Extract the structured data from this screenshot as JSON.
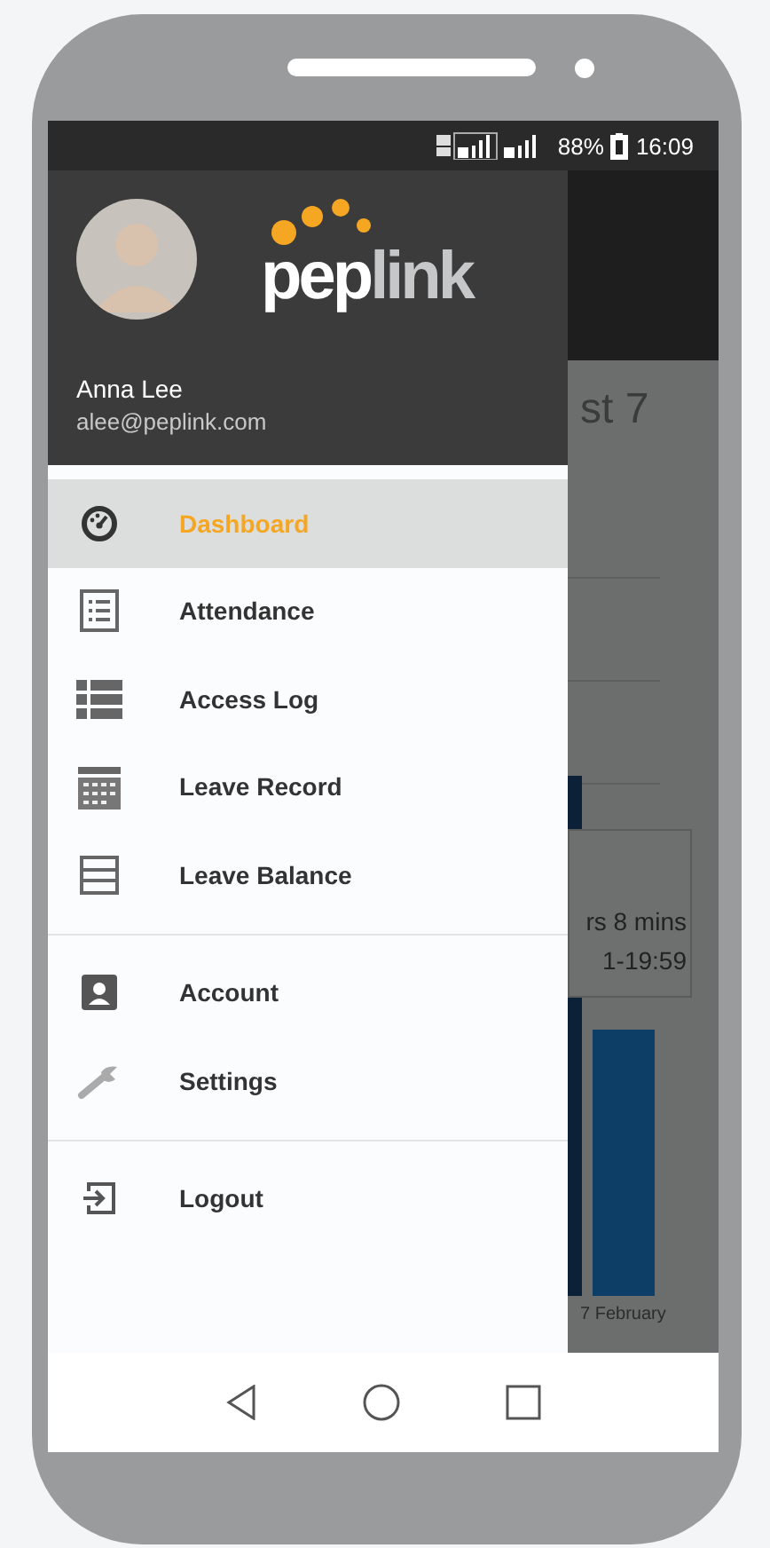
{
  "status_bar": {
    "battery": "88%",
    "time": "16:09"
  },
  "background_page": {
    "heading": "st 7",
    "tooltip_lines": [
      "rs 8 mins",
      "1-19:59"
    ],
    "axis_label": "7 February"
  },
  "drawer": {
    "logo": {
      "parts": [
        "pep",
        "link"
      ]
    },
    "user": {
      "name": "Anna Lee",
      "email": "alee@peplink.com"
    },
    "groups": [
      [
        {
          "label": "Dashboard",
          "kind": "dashboard",
          "selected": true
        },
        {
          "label": "Attendance",
          "kind": "list",
          "selected": false
        },
        {
          "label": "Access Log",
          "kind": "log",
          "selected": false
        },
        {
          "label": "Leave Record",
          "kind": "calendar",
          "selected": false
        },
        {
          "label": "Leave Balance",
          "kind": "balance",
          "selected": false
        }
      ],
      [
        {
          "label": "Account",
          "kind": "account",
          "selected": false
        },
        {
          "label": "Settings",
          "kind": "settings",
          "selected": false
        }
      ],
      [
        {
          "label": "Logout",
          "kind": "logout",
          "selected": false
        }
      ]
    ]
  }
}
